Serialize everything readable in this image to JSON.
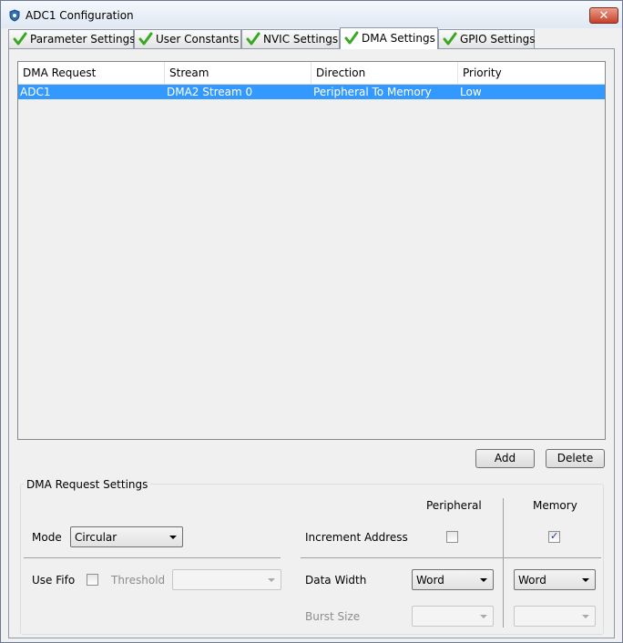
{
  "window": {
    "title": "ADC1 Configuration",
    "close_glyph": "✕"
  },
  "tabs": [
    {
      "label": "Parameter Settings",
      "active": false
    },
    {
      "label": "User Constants",
      "active": false
    },
    {
      "label": "NVIC Settings",
      "active": false
    },
    {
      "label": "DMA Settings",
      "active": true
    },
    {
      "label": "GPIO Settings",
      "active": false
    }
  ],
  "table": {
    "headers": [
      "DMA Request",
      "Stream",
      "Direction",
      "Priority"
    ],
    "rows": [
      {
        "request": "ADC1",
        "stream": "DMA2 Stream 0",
        "direction": "Peripheral To Memory",
        "priority": "Low",
        "selected": true
      }
    ]
  },
  "buttons": {
    "add": "Add",
    "delete": "Delete"
  },
  "settings": {
    "group_title": "DMA Request Settings",
    "peripheral_header": "Peripheral",
    "memory_header": "Memory",
    "mode_label": "Mode",
    "mode_value": "Circular",
    "increment_address_label": "Increment Address",
    "increment_peripheral_checked": false,
    "increment_memory_checked": true,
    "use_fifo_label": "Use Fifo",
    "use_fifo_checked": false,
    "threshold_label": "Threshold",
    "threshold_value": "",
    "data_width_label": "Data Width",
    "data_width_peripheral": "Word",
    "data_width_memory": "Word",
    "burst_size_label": "Burst Size",
    "burst_peripheral": "",
    "burst_memory": ""
  },
  "colors": {
    "selection": "#3399ff",
    "check_icon": "#3aa822"
  }
}
